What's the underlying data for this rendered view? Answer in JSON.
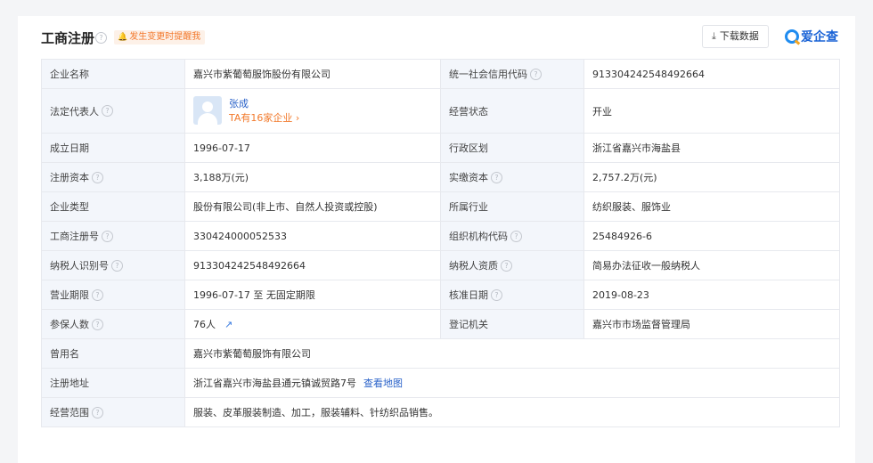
{
  "header": {
    "title": "工商注册",
    "remind_label": "发生变更时提醒我",
    "download_label": "下载数据",
    "brand_name": "爱企查"
  },
  "rows": {
    "r1": {
      "l1": "企业名称",
      "v1": "嘉兴市紫葡萄服饰股份有限公司",
      "l2": "统一社会信用代码",
      "v2": "913304242548492664"
    },
    "r2": {
      "l1": "法定代表人",
      "rep_name": "张成",
      "rep_link": "TA有16家企业",
      "l2": "经营状态",
      "v2": "开业"
    },
    "r3": {
      "l1": "成立日期",
      "v1": "1996-07-17",
      "l2": "行政区划",
      "v2": "浙江省嘉兴市海盐县"
    },
    "r4": {
      "l1": "注册资本",
      "v1": "3,188万(元)",
      "l2": "实缴资本",
      "v2": "2,757.2万(元)"
    },
    "r5": {
      "l1": "企业类型",
      "v1": "股份有限公司(非上市、自然人投资或控股)",
      "l2": "所属行业",
      "v2": "纺织服装、服饰业"
    },
    "r6": {
      "l1": "工商注册号",
      "v1": "330424000052533",
      "l2": "组织机构代码",
      "v2": "25484926-6"
    },
    "r7": {
      "l1": "纳税人识别号",
      "v1": "913304242548492664",
      "l2": "纳税人资质",
      "v2": "简易办法征收一般纳税人"
    },
    "r8": {
      "l1": "营业期限",
      "v1": "1996-07-17 至 无固定期限",
      "l2": "核准日期",
      "v2": "2019-08-23"
    },
    "r9": {
      "l1": "参保人数",
      "v1": "76人",
      "l2": "登记机关",
      "v2": "嘉兴市市场监督管理局"
    },
    "r10": {
      "l1": "曾用名",
      "v1": "嘉兴市紫葡萄服饰有限公司"
    },
    "r11": {
      "l1": "注册地址",
      "v1": "浙江省嘉兴市海盐县通元镇诚贸路7号",
      "map_link": "查看地图"
    },
    "r12": {
      "l1": "经营范围",
      "v1": "服装、皮革服装制造、加工，服装辅料、针纺织品销售。"
    }
  },
  "colors": {
    "accent_blue": "#2a62c9",
    "accent_orange": "#f27a2c",
    "label_bg": "#f3f6fb",
    "border": "#e7e9ee"
  },
  "icons": [
    "help-icon",
    "bell-icon",
    "download-icon",
    "chevron-right-icon",
    "trend-chart-icon",
    "avatar-icon"
  ]
}
